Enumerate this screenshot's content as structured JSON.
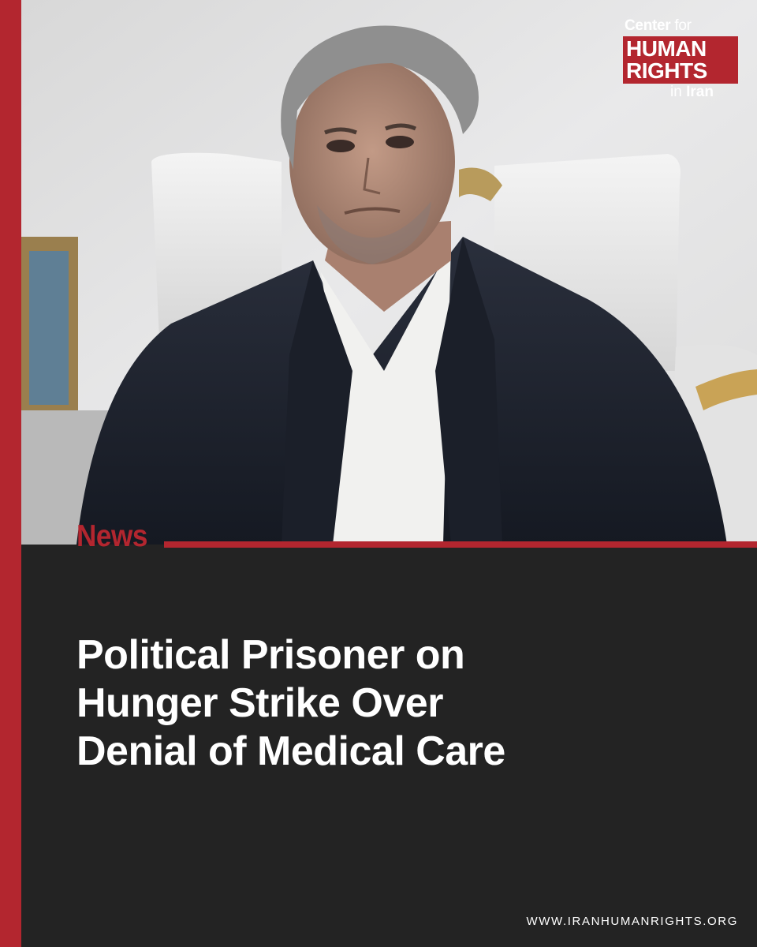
{
  "logo": {
    "line1_bold": "Center",
    "line1_light": "for",
    "line2": "HUMAN",
    "line3": "RIGHTS",
    "line4_light": "in",
    "line4_bold": "Iran"
  },
  "category": "News",
  "headline": {
    "lines": [
      "Political Prisoner on",
      "Hunger Strike Over",
      "Denial of Medical Care"
    ]
  },
  "footer": {
    "url": "WWW.IRANHUMANRIGHTS.ORG"
  },
  "colors": {
    "accent": "#b3262f",
    "background": "#232323",
    "text": "#ffffff"
  }
}
